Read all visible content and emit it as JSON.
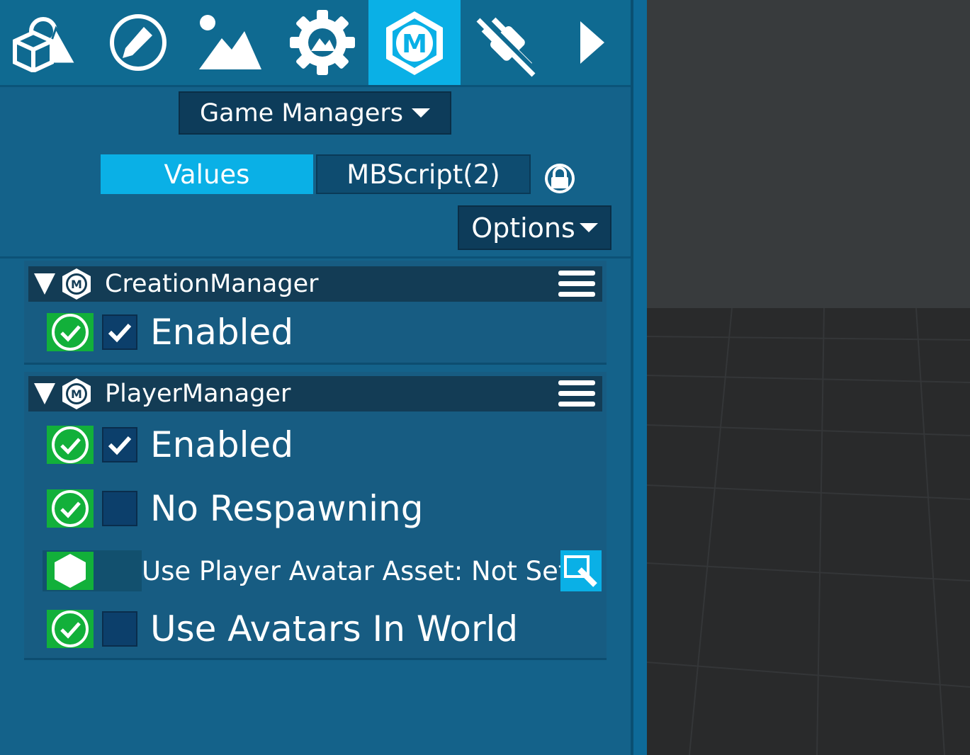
{
  "toolbar": {
    "tools": [
      {
        "icon": "shapes-icon"
      },
      {
        "icon": "edit-pencil-icon"
      },
      {
        "icon": "landscape-icon"
      },
      {
        "icon": "settings-gear-icon"
      },
      {
        "icon": "game-managers-m-icon",
        "letter": "M",
        "active": true
      },
      {
        "icon": "plugin-icon"
      },
      {
        "icon": "next-arrow-icon"
      }
    ]
  },
  "manager_dropdown": {
    "label": "Game Managers"
  },
  "tabs": {
    "values": "Values",
    "script": "MBScript(2)"
  },
  "options": {
    "label": "Options"
  },
  "managers": [
    {
      "name": "CreationManager",
      "badge": "M",
      "properties": [
        {
          "label": "Enabled",
          "checked": true
        }
      ]
    },
    {
      "name": "PlayerManager",
      "badge": "M",
      "properties": [
        {
          "label": "Enabled",
          "checked": true
        },
        {
          "label": "No Respawning",
          "checked": false
        },
        {
          "label": "Use Player Avatar Asset: Not Set"
        },
        {
          "label": "Use Avatars In World",
          "checked": false
        }
      ]
    }
  ],
  "colors": {
    "panel": "#14628a",
    "accent": "#0ab0e6",
    "status_green": "#12b03a",
    "header_dark": "#133c55"
  }
}
